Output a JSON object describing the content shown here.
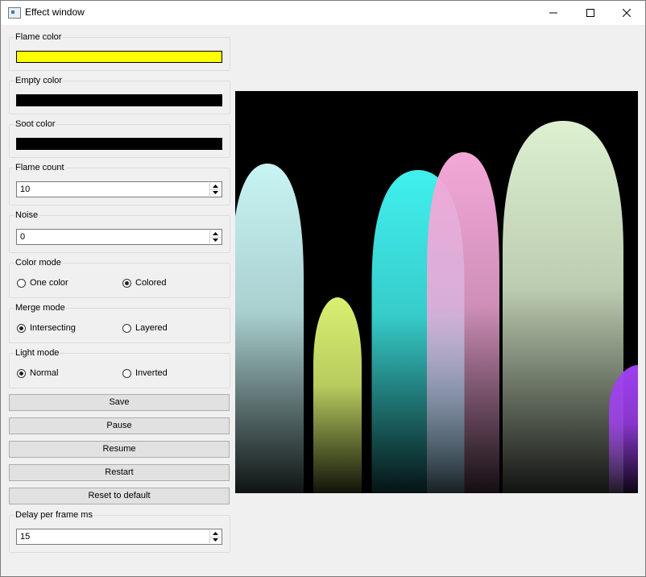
{
  "window": {
    "title": "Effect window"
  },
  "controls": {
    "flame_color": {
      "label": "Flame color",
      "color": "#ffff00"
    },
    "empty_color": {
      "label": "Empty color",
      "color": "#000000"
    },
    "soot_color": {
      "label": "Soot color",
      "color": "#000000"
    },
    "flame_count": {
      "label": "Flame count",
      "value": "10"
    },
    "noise": {
      "label": "Noise",
      "value": "0"
    },
    "color_mode": {
      "label": "Color mode",
      "options": [
        "One color",
        "Colored"
      ],
      "selected": "Colored"
    },
    "merge_mode": {
      "label": "Merge mode",
      "options": [
        "Intersecting",
        "Layered"
      ],
      "selected": "Intersecting"
    },
    "light_mode": {
      "label": "Light mode",
      "options": [
        "Normal",
        "Inverted"
      ],
      "selected": "Normal"
    },
    "delay": {
      "label": "Delay per frame ms",
      "value": "15"
    }
  },
  "buttons": {
    "save": "Save",
    "pause": "Pause",
    "resume": "Resume",
    "restart": "Restart",
    "reset": "Reset to default"
  },
  "flames": [
    {
      "color": "#c8f4f4"
    },
    {
      "color": "#d8f070"
    },
    {
      "color": "#40f0ee"
    },
    {
      "color": "#f3a8d8"
    },
    {
      "color": "#ddf0d0"
    },
    {
      "color": "#a040f0"
    }
  ],
  "icons": [
    "app-icon",
    "minimize-icon",
    "maximize-icon",
    "close-icon",
    "spin-up-icon",
    "spin-down-icon"
  ]
}
